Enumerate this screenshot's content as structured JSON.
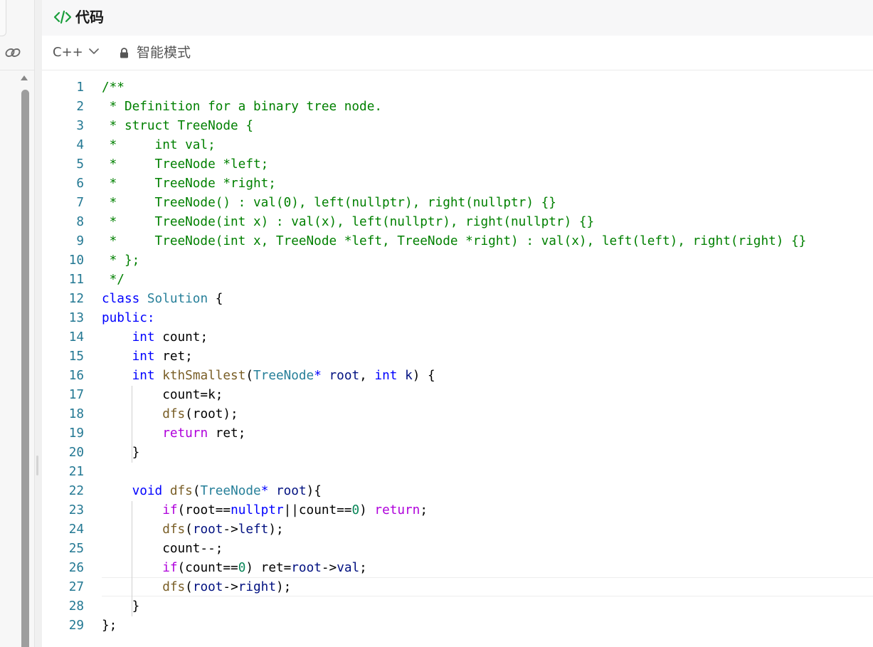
{
  "panel": {
    "title": "代码"
  },
  "toolbar": {
    "language": "C++",
    "mode": "智能模式"
  },
  "icons": {
    "code": "code-icon",
    "chevron": "chevron-down-icon",
    "lock": "lock-icon",
    "link": "link-icon"
  },
  "colors": {
    "comment": "#008000",
    "keyword": "#0000ff",
    "type": "#267f99",
    "function": "#795e26",
    "property": "#001080",
    "control": "#af00db",
    "number": "#098658",
    "line_number": "#237893"
  },
  "code": {
    "lines": [
      [
        [
          "cm",
          "/**"
        ]
      ],
      [
        [
          "cm",
          " * Definition for a binary tree node."
        ]
      ],
      [
        [
          "cm",
          " * struct TreeNode {"
        ]
      ],
      [
        [
          "cm",
          " *     int val;"
        ]
      ],
      [
        [
          "cm",
          " *     TreeNode *left;"
        ]
      ],
      [
        [
          "cm",
          " *     TreeNode *right;"
        ]
      ],
      [
        [
          "cm",
          " *     TreeNode() : val(0), left(nullptr), right(nullptr) {}"
        ]
      ],
      [
        [
          "cm",
          " *     TreeNode(int x) : val(x), left(nullptr), right(nullptr) {}"
        ]
      ],
      [
        [
          "cm",
          " *     TreeNode(int x, TreeNode *left, TreeNode *right) : val(x), left(left), right(right) {}"
        ]
      ],
      [
        [
          "cm",
          " * };"
        ]
      ],
      [
        [
          "cm",
          " */"
        ]
      ],
      [
        [
          "kw",
          "class"
        ],
        [
          "pl",
          " "
        ],
        [
          "ty",
          "Solution"
        ],
        [
          "pl",
          " {"
        ]
      ],
      [
        [
          "kw",
          "public:"
        ]
      ],
      [
        [
          "pl",
          "    "
        ],
        [
          "kw",
          "int"
        ],
        [
          "pl",
          " count;"
        ]
      ],
      [
        [
          "pl",
          "    "
        ],
        [
          "kw",
          "int"
        ],
        [
          "pl",
          " ret;"
        ]
      ],
      [
        [
          "pl",
          "    "
        ],
        [
          "kw",
          "int"
        ],
        [
          "pl",
          " "
        ],
        [
          "fn",
          "kthSmallest"
        ],
        [
          "pl",
          "("
        ],
        [
          "ty",
          "TreeNode"
        ],
        [
          "kw",
          "*"
        ],
        [
          "pl",
          " "
        ],
        [
          "pr",
          "root"
        ],
        [
          "pl",
          ", "
        ],
        [
          "kw",
          "int"
        ],
        [
          "pl",
          " "
        ],
        [
          "pr",
          "k"
        ],
        [
          "pl",
          ") {"
        ]
      ],
      [
        [
          "pl",
          "        count=k;"
        ]
      ],
      [
        [
          "pl",
          "        "
        ],
        [
          "fn",
          "dfs"
        ],
        [
          "pl",
          "(root);"
        ]
      ],
      [
        [
          "pl",
          "        "
        ],
        [
          "ct",
          "return"
        ],
        [
          "pl",
          " ret;"
        ]
      ],
      [
        [
          "pl",
          "    }"
        ]
      ],
      [
        [
          "pl",
          ""
        ]
      ],
      [
        [
          "pl",
          "    "
        ],
        [
          "kw",
          "void"
        ],
        [
          "pl",
          " "
        ],
        [
          "fn",
          "dfs"
        ],
        [
          "pl",
          "("
        ],
        [
          "ty",
          "TreeNode"
        ],
        [
          "kw",
          "*"
        ],
        [
          "pl",
          " "
        ],
        [
          "pr",
          "root"
        ],
        [
          "pl",
          "){"
        ]
      ],
      [
        [
          "pl",
          "        "
        ],
        [
          "ct",
          "if"
        ],
        [
          "pl",
          "(root=="
        ],
        [
          "kw",
          "nullptr"
        ],
        [
          "pl",
          "||count=="
        ],
        [
          "nm",
          "0"
        ],
        [
          "pl",
          ") "
        ],
        [
          "ct",
          "return"
        ],
        [
          "pl",
          ";"
        ]
      ],
      [
        [
          "pl",
          "        "
        ],
        [
          "fn",
          "dfs"
        ],
        [
          "pl",
          "("
        ],
        [
          "pr",
          "root"
        ],
        [
          "pl",
          "->"
        ],
        [
          "pr",
          "left"
        ],
        [
          "pl",
          ");"
        ]
      ],
      [
        [
          "pl",
          "        count--;"
        ]
      ],
      [
        [
          "pl",
          "        "
        ],
        [
          "ct",
          "if"
        ],
        [
          "pl",
          "(count=="
        ],
        [
          "nm",
          "0"
        ],
        [
          "pl",
          ") ret="
        ],
        [
          "pr",
          "root"
        ],
        [
          "pl",
          "->"
        ],
        [
          "pr",
          "val"
        ],
        [
          "pl",
          ";"
        ]
      ],
      [
        [
          "pl",
          "        "
        ],
        [
          "fn",
          "dfs"
        ],
        [
          "pl",
          "("
        ],
        [
          "pr",
          "root"
        ],
        [
          "pl",
          "->"
        ],
        [
          "pr",
          "right"
        ],
        [
          "pl",
          ");"
        ]
      ],
      [
        [
          "pl",
          "    }"
        ]
      ],
      [
        [
          "pl",
          "};"
        ]
      ]
    ]
  }
}
